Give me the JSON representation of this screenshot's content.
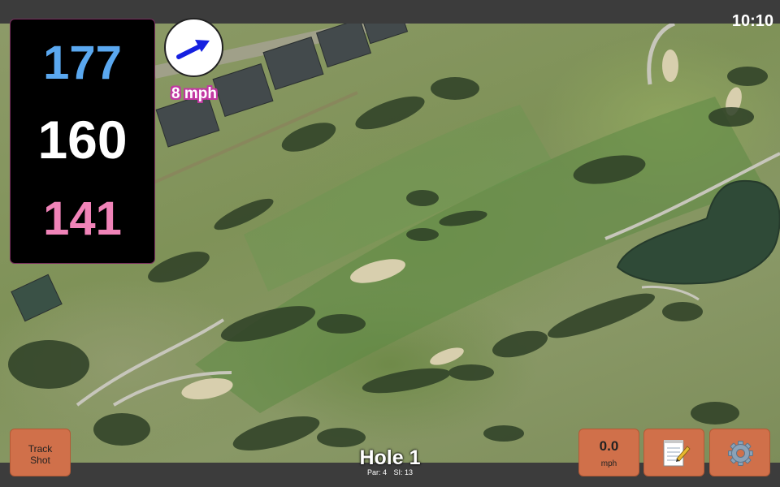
{
  "status_bar": {
    "time": "10:10"
  },
  "yardages": {
    "back": "177",
    "middle": "160",
    "front": "141"
  },
  "wind": {
    "speed_label": "8 mph",
    "direction_icon": "arrow-icon"
  },
  "buttons": {
    "track_shot": "Track\nShot",
    "wind_speed_value": "0.0",
    "wind_speed_unit": "mph",
    "notes_icon": "notepad-icon",
    "settings_icon": "gear-icon"
  },
  "hole": {
    "title": "Hole 1",
    "par": "Par: 4",
    "si": "SI: 13"
  },
  "colors": {
    "back": "#5aa8f0",
    "middle": "#ffffff",
    "front": "#f083b8",
    "button": "#d0704a",
    "wind_label_outline": "#c238a2"
  }
}
